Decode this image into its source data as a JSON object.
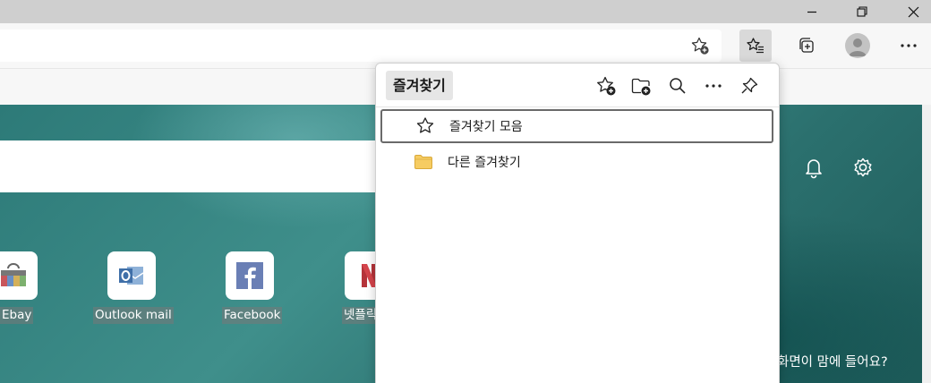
{
  "window": {
    "controls": {
      "minimize": "minimize-icon",
      "restore": "restore-icon",
      "close": "close-icon"
    }
  },
  "toolbar": {
    "address_star_icon": "star-add-icon",
    "favorites_icon": "favorites-list-icon",
    "collections_icon": "collections-add-icon",
    "profile_icon": "avatar",
    "more_icon": "more-icon"
  },
  "ntp": {
    "tiles": [
      {
        "label": "Ebay",
        "icon": "ebay-icon"
      },
      {
        "label": "Outlook mail",
        "icon": "outlook-icon"
      },
      {
        "label": "Facebook",
        "icon": "facebook-icon"
      },
      {
        "label": "넷플릭",
        "icon": "netflix-icon"
      }
    ],
    "bottom_text": "화면이 맘에 들어요?",
    "colors": {
      "accent": "#2d7a78"
    }
  },
  "favorites": {
    "title": "즐겨찾기",
    "items": [
      {
        "label": "즐겨찾기 모음",
        "icon": "star-icon"
      },
      {
        "label": "다른 즐겨찾기",
        "icon": "folder-icon"
      }
    ],
    "folder_color": "#f6cc62"
  }
}
